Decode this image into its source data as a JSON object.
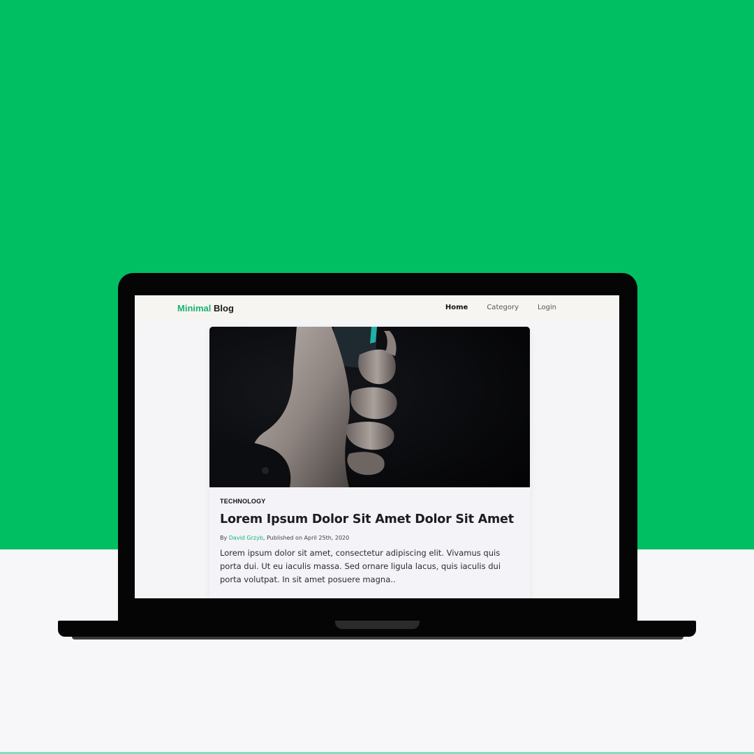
{
  "colors": {
    "background_top": "#00bf63",
    "background_bottom": "#f7f7fa",
    "accent": "#19b46e",
    "laptop": "#050505"
  },
  "navbar": {
    "logo_accent": "Minimal",
    "logo_main": "Blog",
    "links": [
      {
        "label": "Home",
        "active": true
      },
      {
        "label": "Category",
        "active": false
      },
      {
        "label": "Login",
        "active": false
      }
    ]
  },
  "post": {
    "image_icon": "hand-holding-phone-photo",
    "category": "TECHNOLOGY",
    "title": "Lorem Ipsum Dolor Sit Amet Dolor Sit Amet",
    "meta_prefix": "By ",
    "author": "David Grzyb",
    "meta_suffix": ", Published on April 25th, 2020",
    "excerpt": "Lorem ipsum dolor sit amet, consectetur adipiscing elit. Vivamus quis porta dui. Ut eu iaculis massa. Sed ornare ligula lacus, quis iaculis dui porta volutpat. In sit amet posuere magna.."
  }
}
